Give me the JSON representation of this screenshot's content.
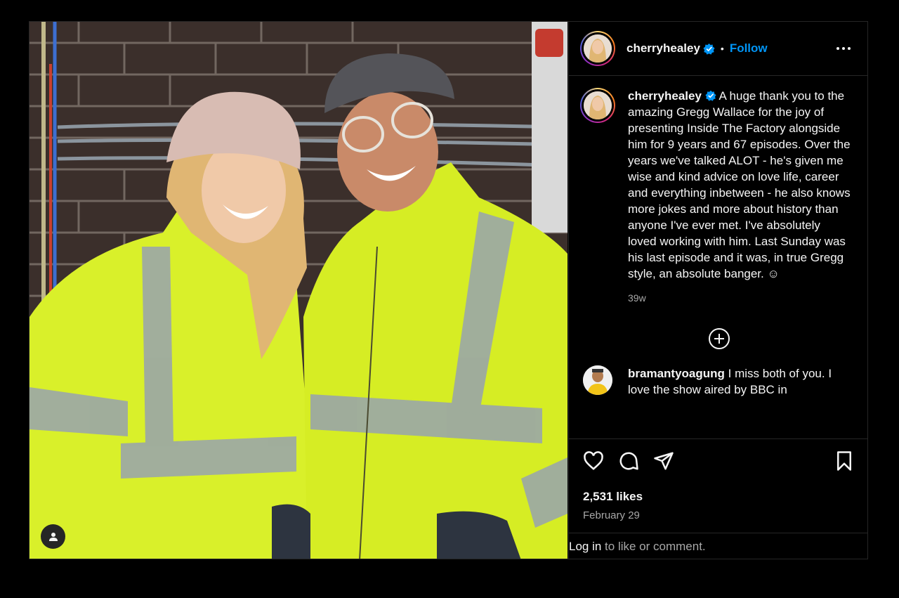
{
  "post": {
    "username": "cherryhealey",
    "follow_label": "Follow",
    "separator": "•",
    "caption": "A huge thank you to the amazing Gregg Wallace for the joy of presenting Inside The Factory alongside him for 9 years and 67 episodes. Over the years we've talked ALOT - he's given me wise and kind advice on love life, career and everything inbetween - he also knows more jokes and more about history than anyone I've ever met. I've absolutely loved working with him. Last Sunday was his last episode and it was, in true Gregg style, an absolute banger. ☺",
    "age": "39w",
    "likes": "2,531 likes",
    "date": "February 29"
  },
  "comment": {
    "username": "bramantyoagung",
    "text": "I miss both of you. I love the show aired by BBC in"
  },
  "footer": {
    "login_label": "Log in",
    "rest": " to like or comment."
  },
  "icons": {
    "more": "more-options-icon",
    "verified": "verified-badge-icon",
    "add": "add-circle-icon",
    "like": "heart-icon",
    "comment": "comment-icon",
    "share": "share-icon",
    "save": "bookmark-icon",
    "user_tag": "user-tag-icon"
  },
  "colors": {
    "accent": "#0095f6",
    "verified": "#0095f6",
    "muted": "#a8a8a8"
  }
}
